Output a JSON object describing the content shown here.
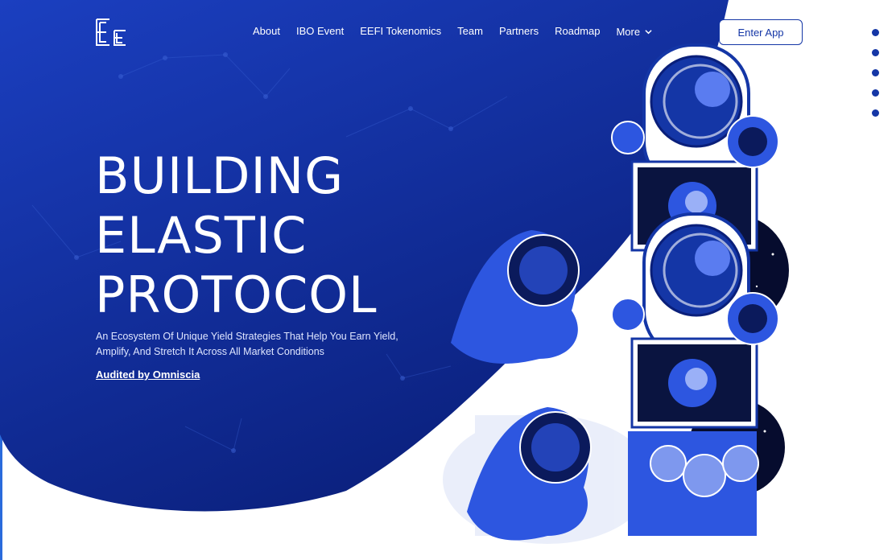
{
  "brand": {
    "logo_letters": "EE"
  },
  "nav": {
    "items": [
      "About",
      "IBO Event",
      "EEFI Tokenomics",
      "Team",
      "Partners",
      "Roadmap"
    ],
    "more_label": "More"
  },
  "cta": {
    "enter_app": "Enter App"
  },
  "hero": {
    "line1": "BUILDING",
    "line2": "ELASTIC",
    "line3": "PROTOCOL",
    "subtitle": "An Ecosystem Of Unique Yield Strategies That Help You Earn Yield, Amplify, And Stretch It Across All Market Conditions",
    "audit_link": "Audited by Omniscia"
  },
  "section_dots": {
    "count": 5
  },
  "colors": {
    "primary_blue": "#1436a6",
    "deep_blue": "#0a1f7a",
    "accent_edge": "#2a6bdc"
  }
}
